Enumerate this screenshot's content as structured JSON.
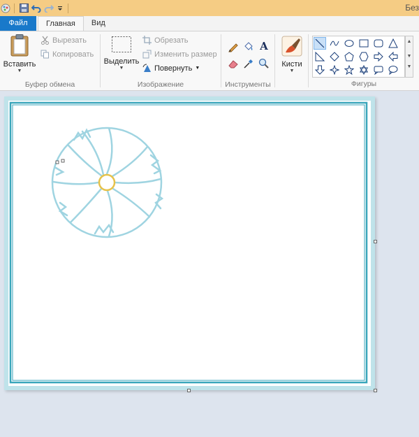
{
  "window": {
    "title": "Без"
  },
  "quick_access": {
    "icons": [
      "paint-app-icon",
      "save-icon",
      "undo-icon",
      "redo-icon",
      "customize-dropdown-icon"
    ]
  },
  "tabs": [
    {
      "label": "Файл"
    },
    {
      "label": "Главная"
    },
    {
      "label": "Вид"
    }
  ],
  "ribbon": {
    "clipboard": {
      "label": "Буфер обмена",
      "paste": "Вставить",
      "cut": "Вырезать",
      "copy": "Копировать"
    },
    "image": {
      "label": "Изображение",
      "select": "Выделить",
      "crop": "Обрезать",
      "resize": "Изменить размер",
      "rotate": "Повернуть"
    },
    "tools": {
      "label": "Инструменты",
      "items": [
        "pencil-icon",
        "fill-icon",
        "text-icon",
        "eraser-icon",
        "color-picker-icon",
        "magnifier-icon"
      ]
    },
    "brushes": {
      "label": "Кисти"
    },
    "shapes": {
      "label": "Фигуры",
      "items": [
        "line",
        "curve",
        "oval",
        "rectangle",
        "rounded-rectangle",
        "triangle",
        "right-triangle",
        "diamond",
        "pentagon",
        "hexagon",
        "right-arrow",
        "left-arrow",
        "up-arrow",
        "down-arrow",
        "four-point-star",
        "five-point-star",
        "six-point-star",
        "rounded-callout",
        "oval-callout",
        "cloud-callout"
      ]
    }
  },
  "colors": {
    "titlebar": "#f5cc84",
    "file_tab": "#1979ca",
    "workspace": "#dde4ee",
    "frame_outer": "#bfe3ea",
    "frame_line": "#3aa6bb",
    "flower": "#9fd4e1",
    "flower_center": "#e6c24a"
  }
}
